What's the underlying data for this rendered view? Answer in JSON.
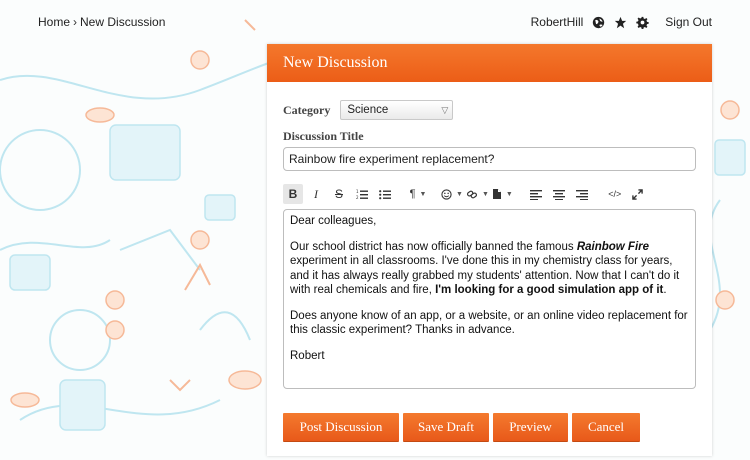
{
  "breadcrumb": {
    "home": "Home",
    "separator": "›",
    "current": "New Discussion"
  },
  "user": {
    "name": "RobertHill",
    "icons": [
      "globe-icon",
      "star-icon",
      "gear-icon"
    ],
    "sign_out": "Sign Out"
  },
  "panel": {
    "title": "New Discussion"
  },
  "form": {
    "category_label": "Category",
    "category_value": "Science",
    "title_label": "Discussion Title",
    "title_value": "Rainbow fire experiment replacement?"
  },
  "toolbar": {
    "bold": "B",
    "italic": "I",
    "strike": "S",
    "paragraph": "¶",
    "emoji": "☺",
    "link": "🔗",
    "code": "</>"
  },
  "editor": {
    "greeting": "Dear colleagues,",
    "p1_a": "Our school district has now officially banned the famous ",
    "p1_em": "Rainbow Fire",
    "p1_b": " experiment in all classrooms.  I've done this in my chemistry class for years, and it has always really grabbed my students' attention.  Now that I can't do it with real chemicals and fire, ",
    "p1_strong": "I'm looking for a good simulation app of it",
    "p1_end": ".",
    "p2": "Does anyone know of an app, or a website, or an online video replacement for this classic experiment?  Thanks in advance.",
    "signature": "Robert"
  },
  "actions": {
    "post": "Post Discussion",
    "draft": "Save Draft",
    "preview": "Preview",
    "cancel": "Cancel"
  },
  "colors": {
    "accent": "#ec5d17",
    "doodle_blue": "#6ec9e0",
    "doodle_orange": "#f08a4b"
  }
}
